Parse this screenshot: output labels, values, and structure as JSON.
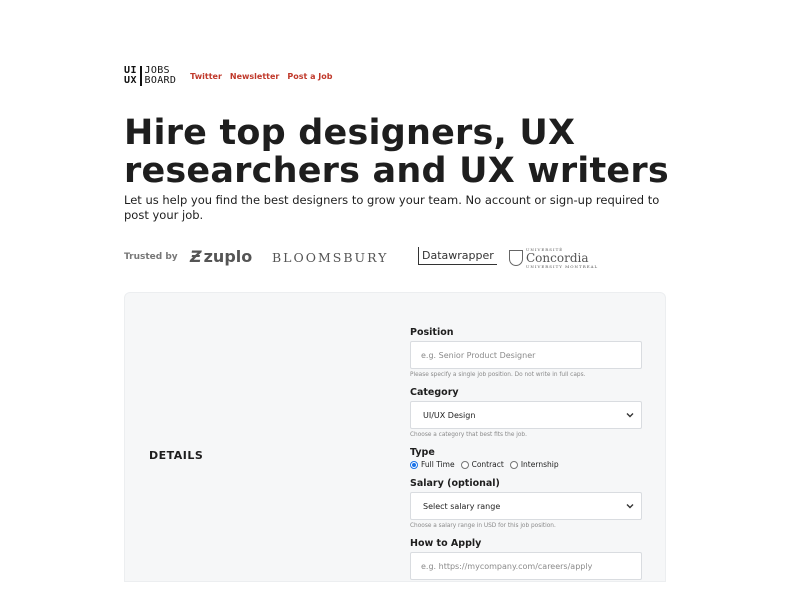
{
  "header": {
    "logo_left_top": "UI",
    "logo_left_bottom": "UX",
    "logo_right_top": "JOBS",
    "logo_right_bottom": "BOARD",
    "nav": [
      {
        "label": "Twitter"
      },
      {
        "label": "Newsletter"
      },
      {
        "label": "Post a Job"
      }
    ]
  },
  "hero": {
    "title": "Hire top designers, UX researchers and UX writers",
    "subtitle": "Let us help you find the best designers to grow your team. No account or sign-up required to post your job."
  },
  "trusted": {
    "label": "Trusted by",
    "brands": {
      "zuplo": "zuplo",
      "bloomsbury": "BLOOMSBURY",
      "datawrapper": "Datawrapper",
      "concordia_top": "UNIVERSITÉ",
      "concordia": "Concordia",
      "concordia_bottom": "UNIVERSITY  MONTREAL"
    }
  },
  "form": {
    "section_title": "DETAILS",
    "position": {
      "label": "Position",
      "placeholder": "e.g. Senior Product Designer",
      "hint": "Please specify a single job position. Do not write in full caps."
    },
    "category": {
      "label": "Category",
      "value": "UI/UX Design",
      "hint": "Choose a category that best fits the job."
    },
    "type": {
      "label": "Type",
      "options": [
        {
          "label": "Full Time"
        },
        {
          "label": "Contract"
        },
        {
          "label": "Internship"
        }
      ]
    },
    "salary": {
      "label": "Salary (optional)",
      "value": "Select salary range",
      "hint": "Choose a salary range in USD for this job position."
    },
    "apply": {
      "label": "How to Apply",
      "placeholder": "e.g. https://mycompany.com/careers/apply"
    }
  }
}
